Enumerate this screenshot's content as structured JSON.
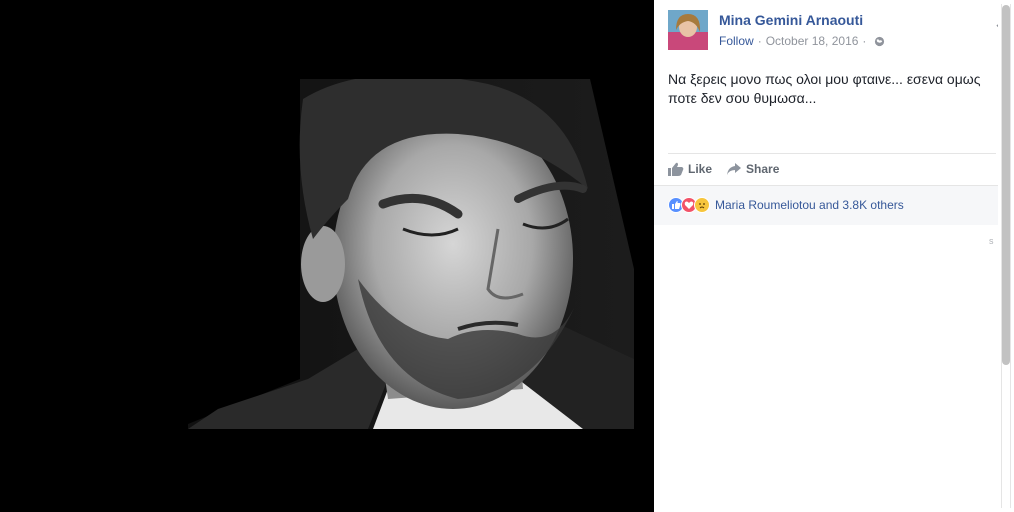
{
  "post": {
    "author": "Mina Gemini Arnaouti",
    "follow_label": "Follow",
    "separator": "·",
    "date": "October 18, 2016",
    "privacy_icon": "globe-icon",
    "menu_icon": "chevron-down-icon",
    "message": "Να ξερεις μονο πως ολοι μου φταινε... εσενα ομως ποτε δεν σου θυμωσα...",
    "actions": [
      {
        "label": "Like",
        "icon": "thumbs-up-icon"
      },
      {
        "label": "Share",
        "icon": "share-arrow-icon"
      }
    ],
    "reactions": {
      "icons": [
        "like-reaction-icon",
        "love-reaction-icon",
        "sad-reaction-icon"
      ],
      "text": "Maria Roumeliotou and 3.8K others"
    },
    "faint_char": "s"
  },
  "photo": {
    "subject": "black-and-white photo of a bearded man looking down"
  },
  "colors": {
    "link": "#365899",
    "meta": "#90949c",
    "text": "#1d2129",
    "like": "#5890ff",
    "love": "#f25268",
    "sad": "#f7c53c"
  }
}
